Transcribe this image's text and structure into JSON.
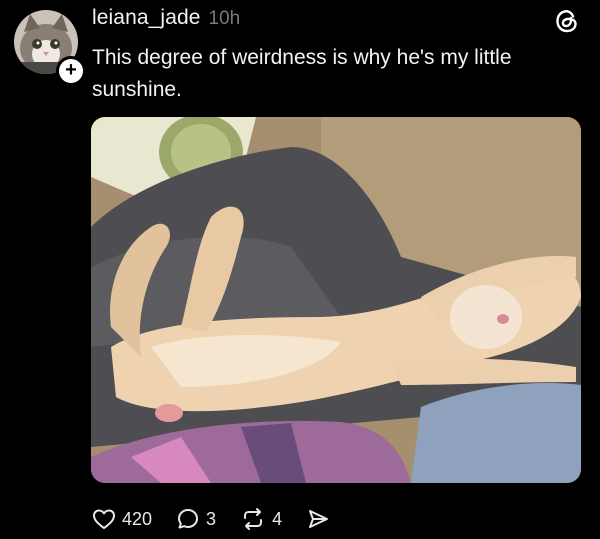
{
  "post": {
    "username": "leiana_jade",
    "timestamp": "10h",
    "caption": "This degree of weirdness is why he's my little sunshine.",
    "follow_symbol": "+"
  },
  "actions": {
    "likes": "420",
    "replies": "3",
    "reposts": "4"
  },
  "icons": {
    "brand": "threads-logo-icon",
    "like": "heart-icon",
    "reply": "speech-bubble-icon",
    "repost": "repost-icon",
    "share": "send-icon"
  },
  "colors": {
    "background": "#000000",
    "text": "#f3f3f3",
    "muted": "#7a7a7a"
  }
}
